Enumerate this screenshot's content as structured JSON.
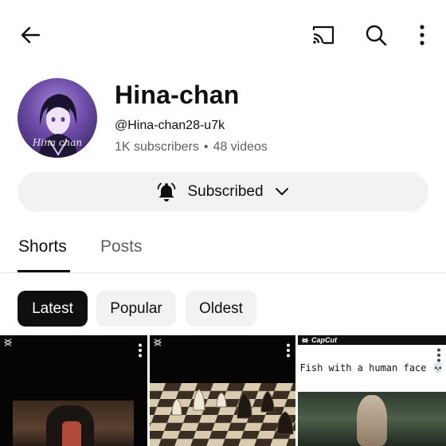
{
  "topbar": {
    "back_icon": "arrow-left-icon",
    "cast_icon": "cast-icon",
    "search_icon": "search-icon",
    "more_icon": "more-vertical-icon"
  },
  "channel": {
    "name": "Hina-chan",
    "handle": "@Hina-chan28-u7k",
    "subscribers": "1K subscribers",
    "separator": "•",
    "videos": "48 videos",
    "avatar_signature": "Hina chan"
  },
  "subscribe_button": {
    "label": "Subscribed",
    "bell_icon": "bell-filled-icon",
    "dropdown_icon": "chevron-down-icon"
  },
  "tabs": [
    {
      "label": "Shorts",
      "active": true
    },
    {
      "label": "Posts",
      "active": false
    }
  ],
  "filters": [
    {
      "label": "Latest",
      "selected": true
    },
    {
      "label": "Popular",
      "selected": false
    },
    {
      "label": "Oldest",
      "selected": false
    }
  ],
  "shorts": [
    {
      "watermark_icon": "capcut-icon"
    },
    {
      "watermark_icon": "capcut-icon"
    },
    {
      "brand": "CapCut",
      "caption": "Fish with a human face 💀"
    }
  ],
  "colors": {
    "text_primary": "#0f0f0f",
    "text_secondary": "#606060",
    "chip_bg": "#f2f2f2",
    "chip_selected_bg": "#0f0f0f"
  }
}
